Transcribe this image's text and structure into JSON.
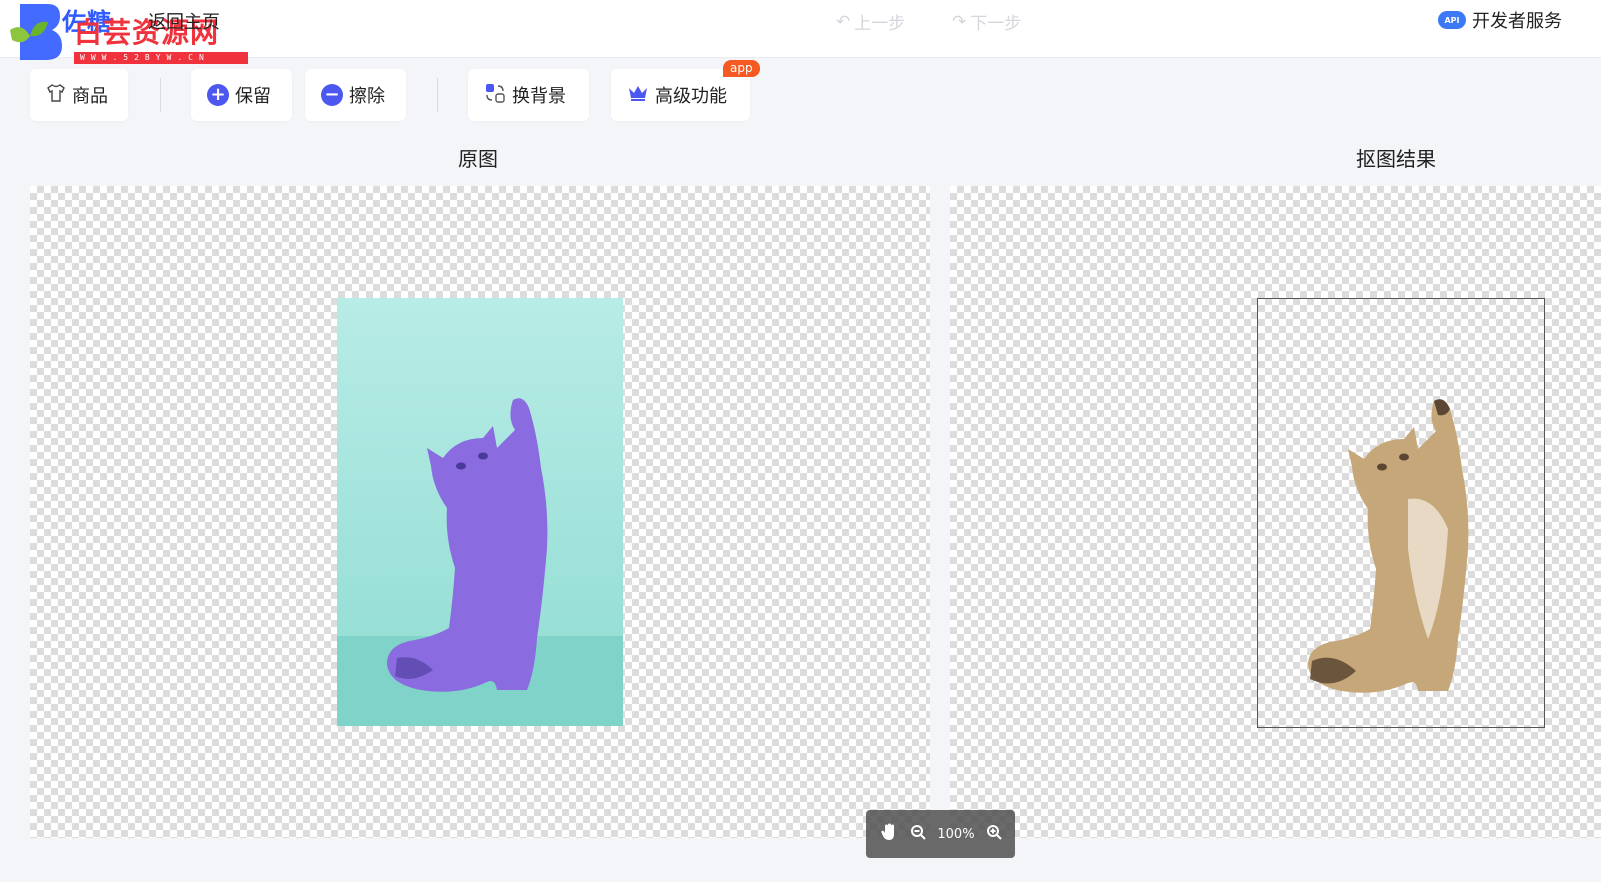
{
  "header": {
    "brand_name": "佐糖",
    "watermark_title": "白芸资源网",
    "watermark_url": "WWW.52BYW.CN",
    "back_label": "返回主页",
    "undo_label": "上一步",
    "redo_label": "下一步",
    "api_badge": "API",
    "dev_service_label": "开发者服务"
  },
  "toolbar": {
    "product_label": "商品",
    "keep_label": "保留",
    "erase_label": "擦除",
    "change_bg_label": "换背景",
    "advanced_label": "高级功能",
    "app_badge": "app",
    "keep_icon_glyph": "+",
    "erase_icon_glyph": "−"
  },
  "panels": {
    "original_title": "原图",
    "result_title": "抠图结果"
  },
  "zoom": {
    "level": "100%"
  },
  "colors": {
    "accent": "#4c57f0",
    "app_badge": "#f45a22",
    "cat_original": "#8a6be0",
    "cat_result": "#c6a77a",
    "photo_background": "#b8ece6"
  }
}
